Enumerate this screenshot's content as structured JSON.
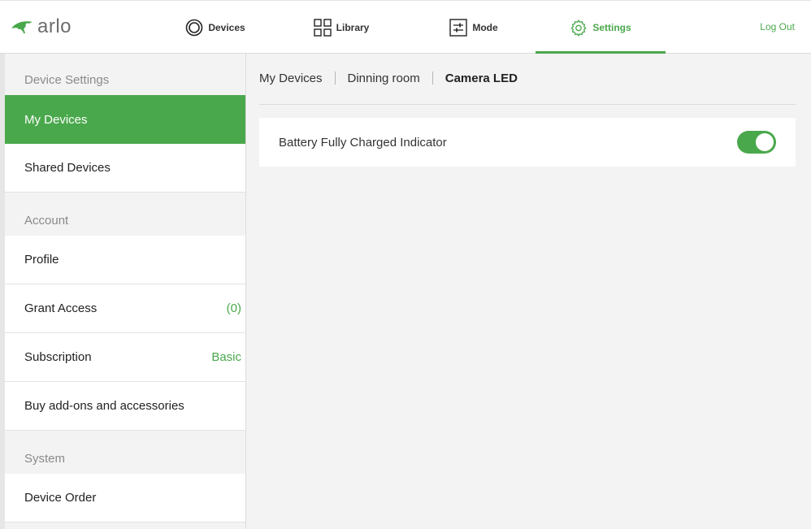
{
  "header": {
    "logo_text": "arlo",
    "nav": {
      "devices": "Devices",
      "library": "Library",
      "mode": "Mode",
      "settings": "Settings"
    },
    "logout": "Log Out",
    "accent_color": "#4aa84c"
  },
  "sidebar": {
    "sections": {
      "device_settings": "Device Settings",
      "account": "Account",
      "system": "System"
    },
    "items": {
      "my_devices": "My Devices",
      "shared_devices": "Shared Devices",
      "profile": "Profile",
      "grant_access": "Grant Access",
      "grant_access_count": "(0)",
      "subscription": "Subscription",
      "subscription_value": "Basic",
      "buy_addons": "Buy add-ons and accessories",
      "device_order": "Device Order"
    }
  },
  "main": {
    "breadcrumb": [
      "My Devices",
      "Dinning room",
      "Camera LED"
    ],
    "setting": {
      "label": "Battery Fully Charged Indicator",
      "enabled": true
    }
  }
}
